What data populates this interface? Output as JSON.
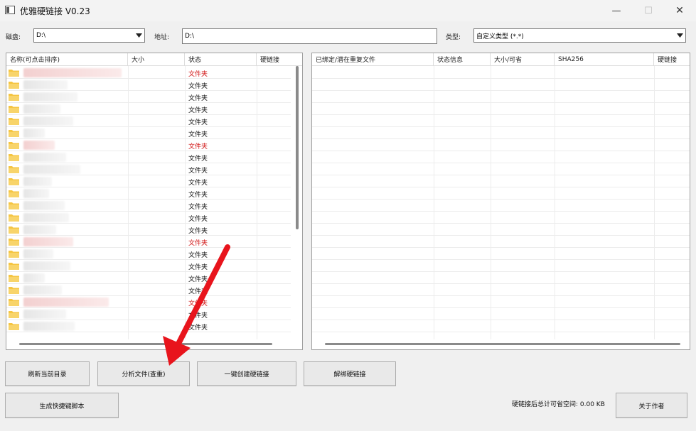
{
  "window": {
    "title": "优雅硬链接 V0.23",
    "minimize_glyph": "—",
    "maximize_glyph": "☐",
    "close_glyph": "✕"
  },
  "toolbar": {
    "disk_label": "磁盘:",
    "disk_value": "D:\\",
    "address_label": "地址:",
    "address_value": "D:\\",
    "type_label": "类型:",
    "type_value": "自定义类型 (*.*)"
  },
  "left_list": {
    "columns": [
      "名称(可点击排序)",
      "大小",
      "状态",
      "硬链接"
    ],
    "rows": [
      {
        "status": "文件夹",
        "red": true,
        "blur_red": true
      },
      {
        "status": "文件夹",
        "red": false,
        "blur_red": false
      },
      {
        "status": "文件夹",
        "red": false,
        "blur_red": false
      },
      {
        "status": "文件夹",
        "red": false,
        "blur_red": false
      },
      {
        "status": "文件夹",
        "red": false,
        "blur_red": false
      },
      {
        "status": "文件夹",
        "red": false,
        "blur_red": false
      },
      {
        "status": "文件夹",
        "red": true,
        "blur_red": true
      },
      {
        "status": "文件夹",
        "red": false,
        "blur_red": false
      },
      {
        "status": "文件夹",
        "red": false,
        "blur_red": false
      },
      {
        "status": "文件夹",
        "red": false,
        "blur_red": false
      },
      {
        "status": "文件夹",
        "red": false,
        "blur_red": false
      },
      {
        "status": "文件夹",
        "red": false,
        "blur_red": false
      },
      {
        "status": "文件夹",
        "red": false,
        "blur_red": false
      },
      {
        "status": "文件夹",
        "red": false,
        "blur_red": false
      },
      {
        "status": "文件夹",
        "red": true,
        "blur_red": true
      },
      {
        "status": "文件夹",
        "red": false,
        "blur_red": false
      },
      {
        "status": "文件夹",
        "red": false,
        "blur_red": false
      },
      {
        "status": "文件夹",
        "red": false,
        "blur_red": false
      },
      {
        "status": "文件夹",
        "red": false,
        "blur_red": false
      },
      {
        "status": "文件夹",
        "red": true,
        "blur_red": true
      },
      {
        "status": "文件夹",
        "red": false,
        "blur_red": false
      },
      {
        "status": "文件夹",
        "red": false,
        "blur_red": false
      }
    ]
  },
  "right_list": {
    "columns": [
      "已绑定/潜在重复文件",
      "状态信息",
      "大小/可省",
      "SHA256",
      "硬链接"
    ]
  },
  "buttons": {
    "refresh": "刷新当前目录",
    "analyze": "分析文件(查重)",
    "create": "一键创建硬链接",
    "unbind": "解绑硬链接",
    "script": "生成快捷键脚本",
    "about": "关于作者"
  },
  "footer": {
    "saved_space": "硬链接后总计可省空间: 0.00 KB"
  },
  "colors": {
    "accent_red": "#e8141c",
    "status_red": "#d01010",
    "folder_yellow": "#f5c542"
  },
  "icons": {
    "app": "app-icon",
    "folder": "folder-icon",
    "dropdown": "chevron-down-icon",
    "annotation": "red-arrow-icon"
  }
}
